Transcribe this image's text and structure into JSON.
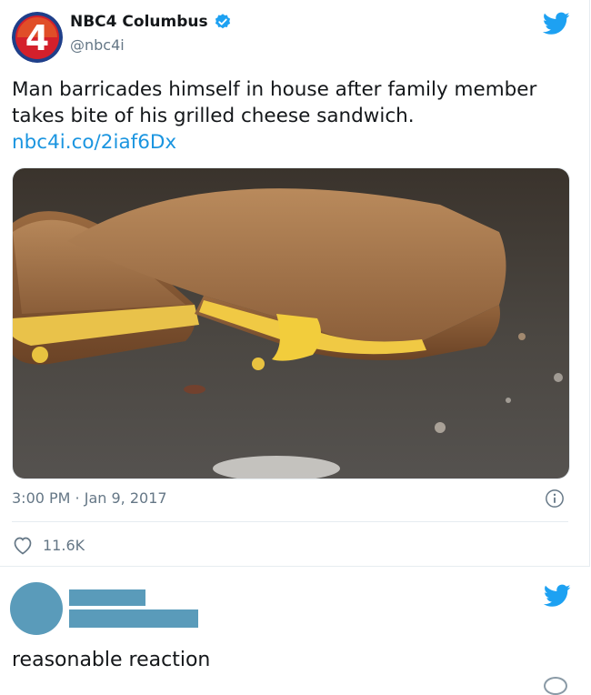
{
  "tweet": {
    "author_name": "NBC4 Columbus",
    "author_handle": "@nbc4i",
    "logo_text": "4",
    "text": "Man barricades himself in house after family member takes bite of his grilled cheese sandwich.",
    "link": "nbc4i.co/2iaf6Dx",
    "timestamp": "3:00 PM · Jan 9, 2017",
    "likes": "11.6K",
    "photo_icon": "grilled-cheese-photo",
    "info_icon": "info-icon",
    "like_icon": "heart-icon",
    "brand_icon": "twitter-bird-icon"
  },
  "reply": {
    "text": "reasonable reaction",
    "author_redacted": true,
    "brand_icon": "twitter-bird-icon"
  },
  "colors": {
    "twitter_blue": "#1da1f2",
    "link": "#1b95e0",
    "muted": "#657786",
    "redaction": "#5a9bba",
    "nbc_red": "#d4202b"
  }
}
